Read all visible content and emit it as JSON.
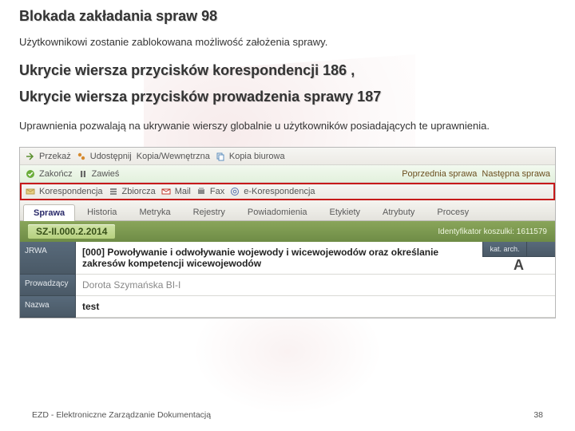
{
  "headings": {
    "h1": "Blokada zakładania spraw 98",
    "p1": "Użytkownikowi zostanie zablokowana możliwość założenia sprawy.",
    "h2": "Ukrycie wiersza przycisków korespondencji 186 ,",
    "h3": "Ukrycie wiersza przycisków prowadzenia sprawy 187",
    "p2": "Uprawnienia pozwalają na ukrywanie wierszy globalnie u użytkowników posiadających te uprawnienia."
  },
  "toolbar1": {
    "przekaz": "Przekaż",
    "udostepnij": "Udostępnij",
    "kopia_wew": "Kopia/Wewnętrzna",
    "kopia_biur": "Kopia biurowa"
  },
  "toolbar2": {
    "zakoncz": "Zakończ",
    "zawies": "Zawieś",
    "poprzednia": "Poprzednia sprawa",
    "nastepna": "Następna sprawa"
  },
  "toolbar3": {
    "koresp": "Korespondencja",
    "zbiorcza": "Zbiorcza",
    "mail": "Mail",
    "fax": "Fax",
    "ekoresp": "e-Korespondencja"
  },
  "tabs": [
    "Sprawa",
    "Historia",
    "Metryka",
    "Rejestry",
    "Powiadomienia",
    "Etykiety",
    "Atrybuty",
    "Procesy"
  ],
  "case": {
    "number": "SZ-II.000.2.2014",
    "meta_label": "Identyfikator koszulki:",
    "meta_value": "1611579"
  },
  "fields": {
    "jrwa_lab": "JRWA",
    "jrwa_val": "[000] Powoływanie i odwoływanie wojewody i wicewojewodów oraz określanie zakresów kompetencji wicewojewodów",
    "arch_lab": "kat. arch.",
    "arch_val": "A",
    "prow_lab": "Prowadzący",
    "prow_val": "Dorota Szymańska BI-I",
    "nazwa_lab": "Nazwa",
    "nazwa_val": "test"
  },
  "footer": {
    "left": "EZD - Elektroniczne Zarządzanie Dokumentacją",
    "right": "38"
  }
}
